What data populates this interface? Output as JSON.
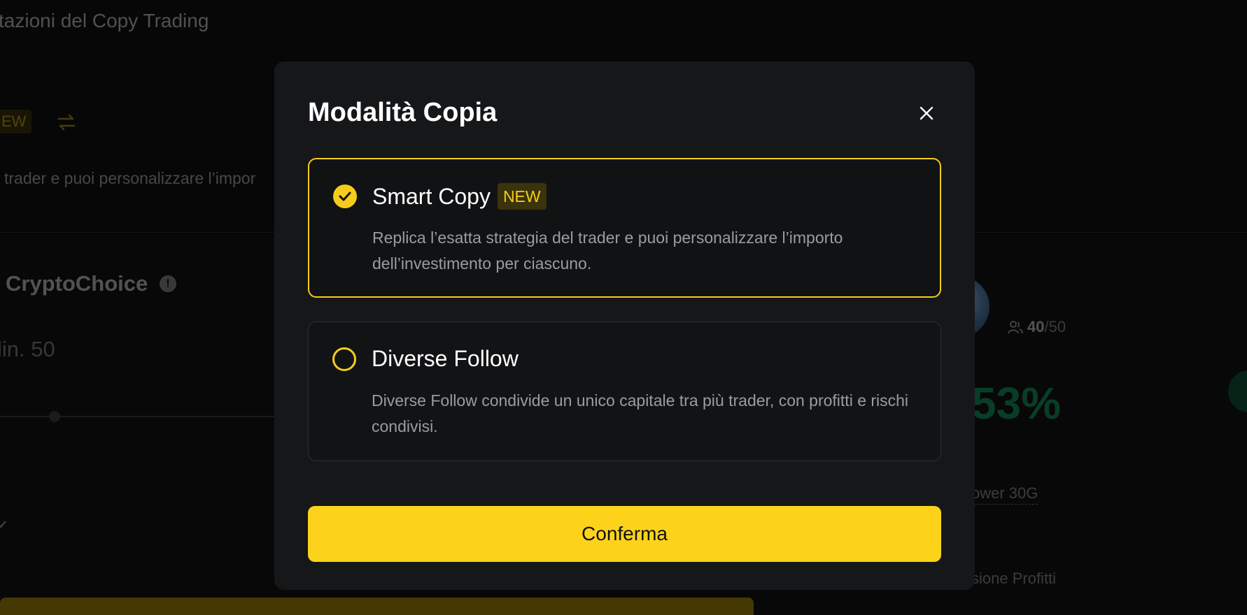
{
  "background": {
    "page_title": "tazioni del Copy Trading",
    "new_badge": "EW",
    "description": "trader e puoi personalizzare l’impor",
    "trader_name": "CryptoChoice",
    "info_glyph": "!",
    "min_amount": "lin. 50",
    "followers_current": "40",
    "followers_separator": "/",
    "followers_max": "50",
    "roi_percent": "53%",
    "follower_stat_label": "ower 30G",
    "profit_label": "sione Profitti"
  },
  "modal": {
    "title": "Modalità Copia",
    "options": [
      {
        "title": "Smart Copy",
        "badge": "NEW",
        "description": "Replica l’esatta strategia del trader e puoi personalizzare l’importo dell’investimento per ciascuno.",
        "selected": true
      },
      {
        "title": "Diverse Follow",
        "badge": "",
        "description": "Diverse Follow condivide un unico capitale tra più trader, con profitti e rischi condivisi.",
        "selected": false
      }
    ],
    "confirm_label": "Conferma"
  },
  "colors": {
    "accent": "#fcd31a",
    "modal_bg": "#161719",
    "profit_green": "#0f8a55"
  },
  "icons": [
    "switch-icon",
    "info-icon",
    "people-icon",
    "close-icon",
    "check-icon",
    "chevron-down-icon"
  ]
}
